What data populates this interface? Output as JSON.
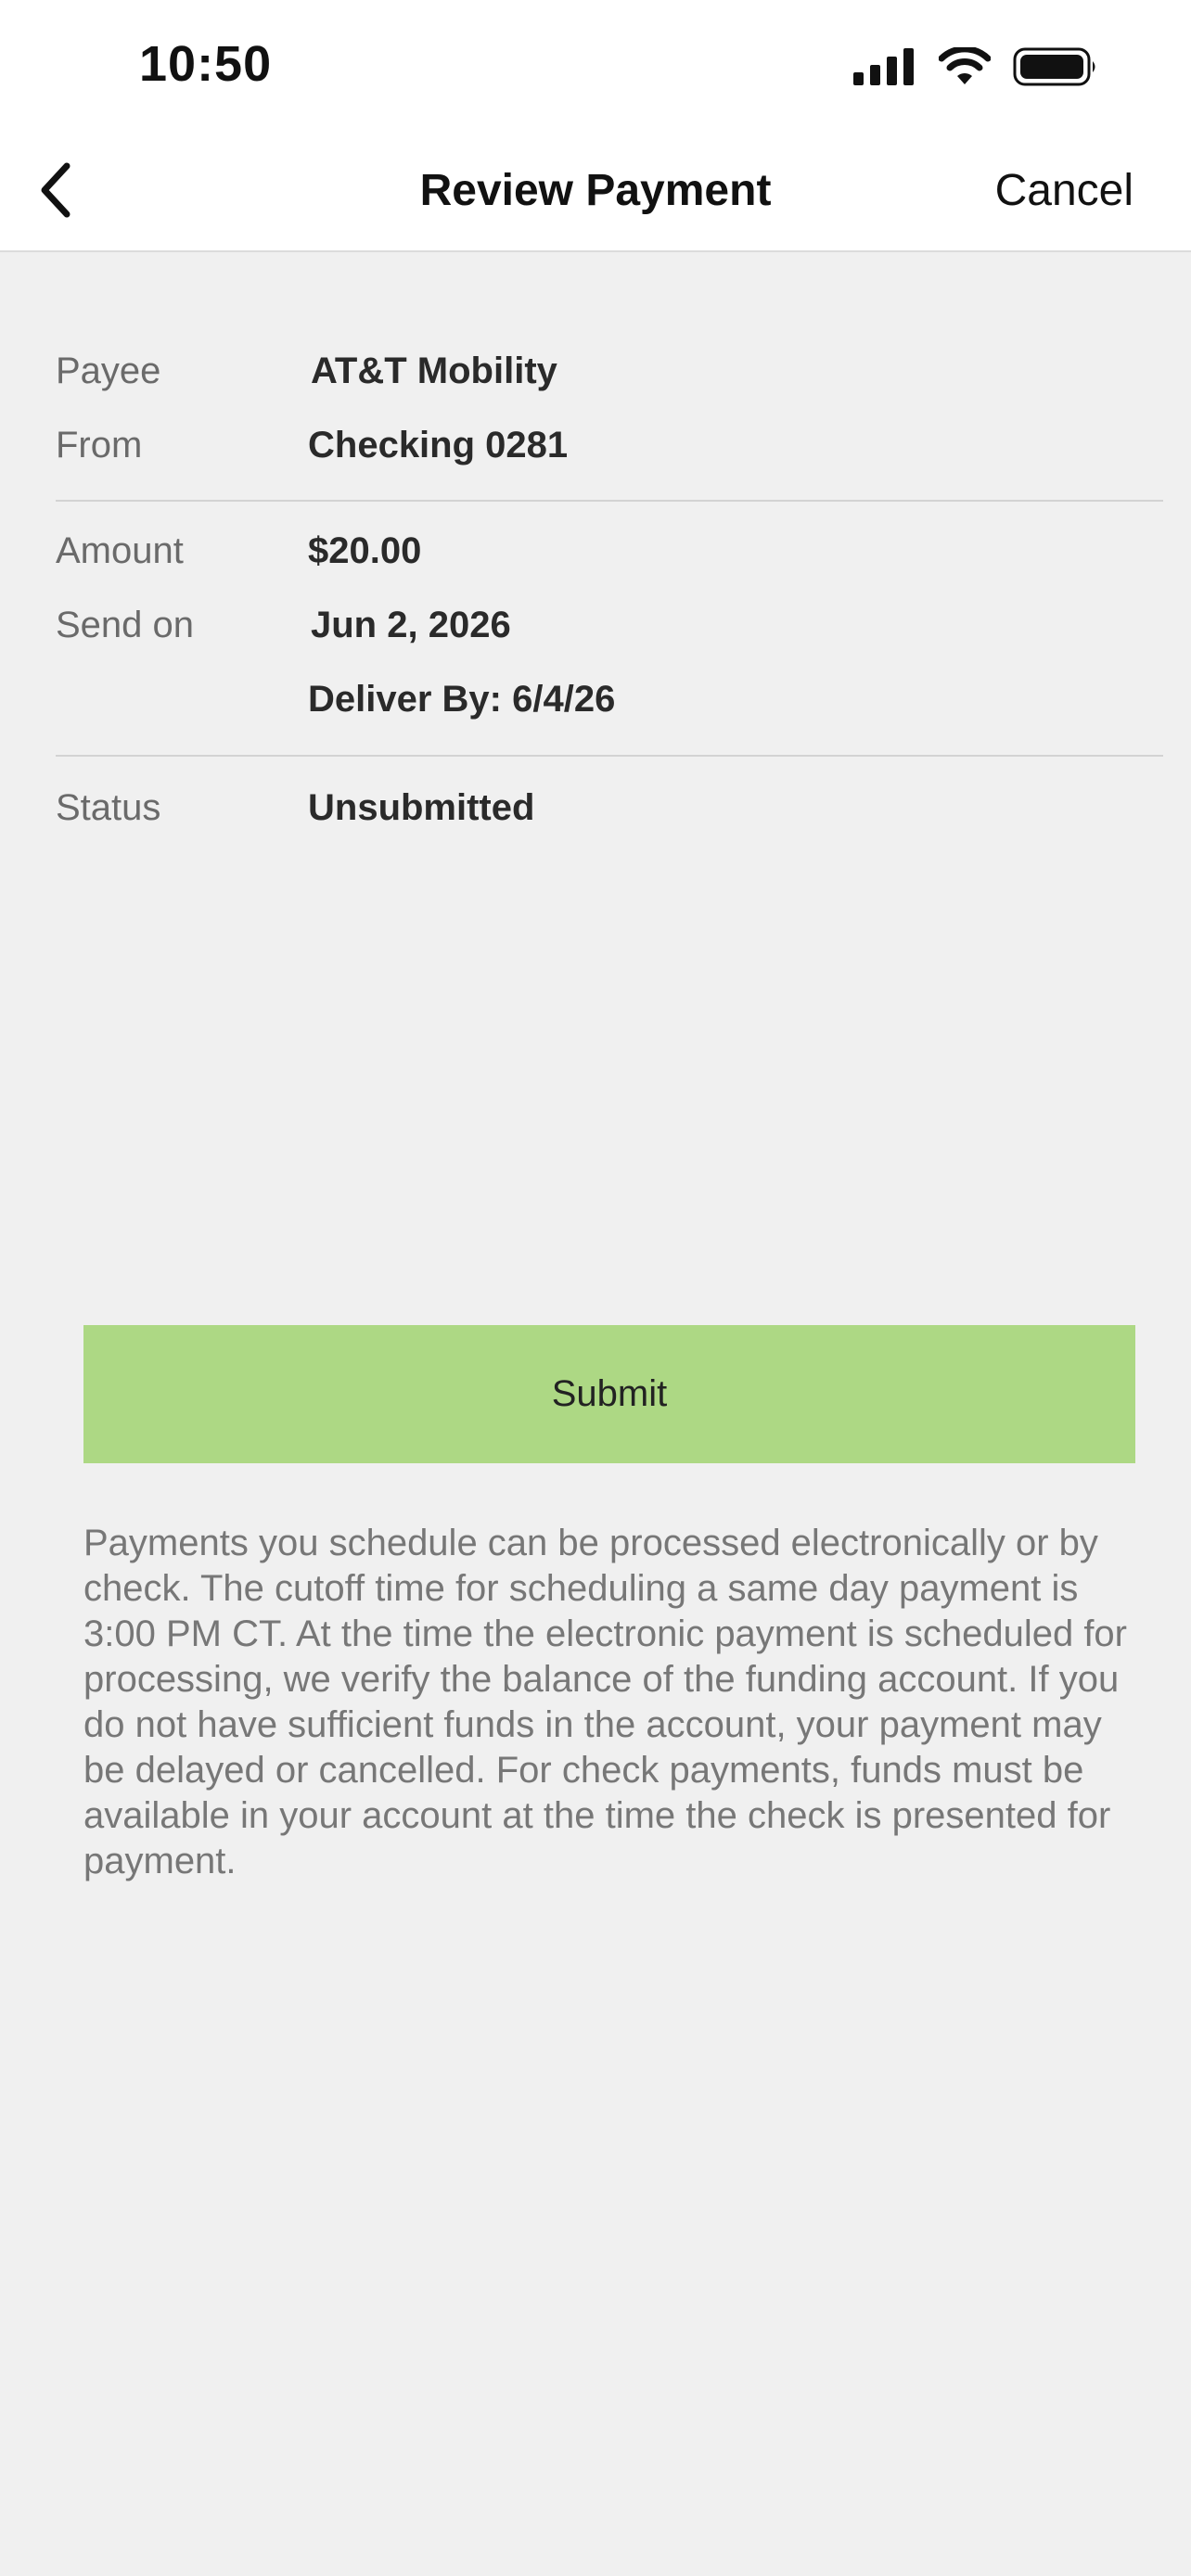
{
  "status_bar": {
    "time": "10:50",
    "icons": [
      "cellular-signal-icon",
      "wifi-icon",
      "battery-icon"
    ]
  },
  "nav": {
    "back_icon": "chevron-left-icon",
    "title": "Review Payment",
    "cancel_label": "Cancel"
  },
  "details": {
    "payee": {
      "label": "Payee",
      "value": "AT&T Mobility"
    },
    "from": {
      "label": "From",
      "value": "Checking 0281"
    },
    "amount": {
      "label": "Amount",
      "value": "$20.00"
    },
    "send_on": {
      "label": "Send on",
      "value": "Jun 2, 2026"
    },
    "deliver_by": "Deliver By: 6/4/26",
    "status": {
      "label": "Status",
      "value": "Unsubmitted"
    }
  },
  "actions": {
    "submit_label": "Submit"
  },
  "disclaimer": "Payments you schedule can be processed electronically or by check. The cutoff time for scheduling a same day payment is 3:00 PM CT. At the time the electronic payment is scheduled for processing, we verify the balance of the funding account. If you do not have sufficient funds in the account, your payment may be delayed or cancelled. For check payments, funds must be available in your account at the time the check is presented for payment.",
  "colors": {
    "background": "#f0f0f0",
    "header_background": "#ffffff",
    "submit_button": "#add884",
    "label_text": "#6a6a6a",
    "value_text": "#2a2a2a",
    "disclaimer_text": "#777777"
  }
}
